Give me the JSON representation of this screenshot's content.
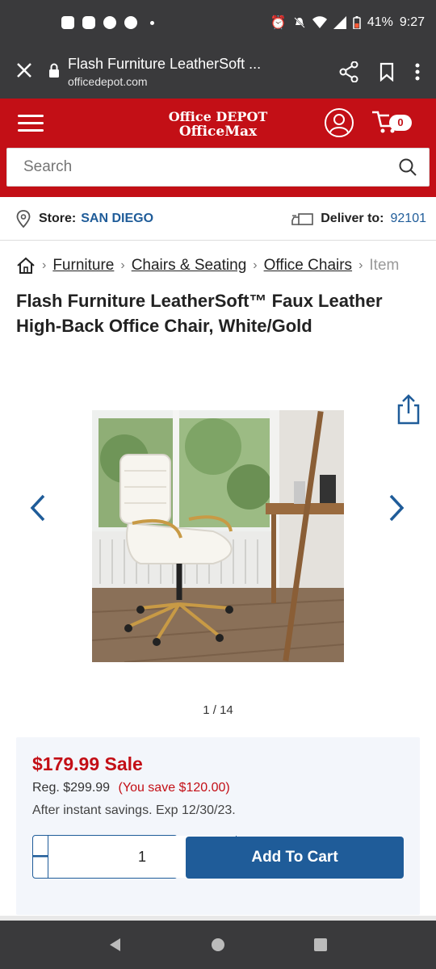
{
  "status_bar": {
    "battery": "41%",
    "time": "9:27"
  },
  "browser": {
    "page_title": "Flash Furniture LeatherSoft ...",
    "domain": "officedepot.com"
  },
  "header": {
    "logo_line1": "Office DEPOT",
    "logo_line2": "OfficeMax",
    "cart_count": "0",
    "search_placeholder": "Search"
  },
  "store_bar": {
    "store_label": "Store:",
    "store_name": "SAN DIEGO",
    "deliver_label": "Deliver to:",
    "deliver_zip": "92101"
  },
  "breadcrumbs": {
    "items": [
      "Furniture",
      "Chairs & Seating",
      "Office Chairs"
    ],
    "current": "Item"
  },
  "product": {
    "title": "Flash Furniture LeatherSoft™ Faux Leather High-Back Office Chair, White/Gold",
    "image_counter": "1 / 14",
    "sale_price": "$179.99 Sale",
    "reg_price": "Reg. $299.99",
    "you_save": "(You save $120.00)",
    "savings_note": "After instant savings. Exp 12/30/23.",
    "quantity": "1",
    "add_to_cart_label": "Add To Cart"
  },
  "colors": {
    "brand_red": "#c30f16",
    "link_blue": "#1f5c99",
    "chrome_dark": "#3a3a3c"
  }
}
